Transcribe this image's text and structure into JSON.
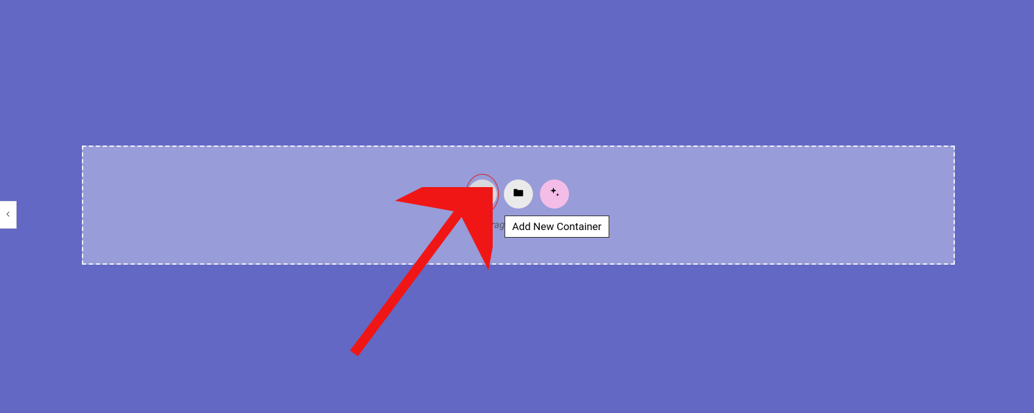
{
  "panel": {
    "collapse_label": "Collapse panel"
  },
  "dropzone": {
    "hint": "Drag widget here",
    "buttons": {
      "add": "Add",
      "folder": "Folder",
      "ai": "AI"
    },
    "tooltip": "Add New Container"
  },
  "colors": {
    "background": "#6268c4",
    "highlight": "#d61f1f",
    "ai_btn": "#f3bde8"
  }
}
